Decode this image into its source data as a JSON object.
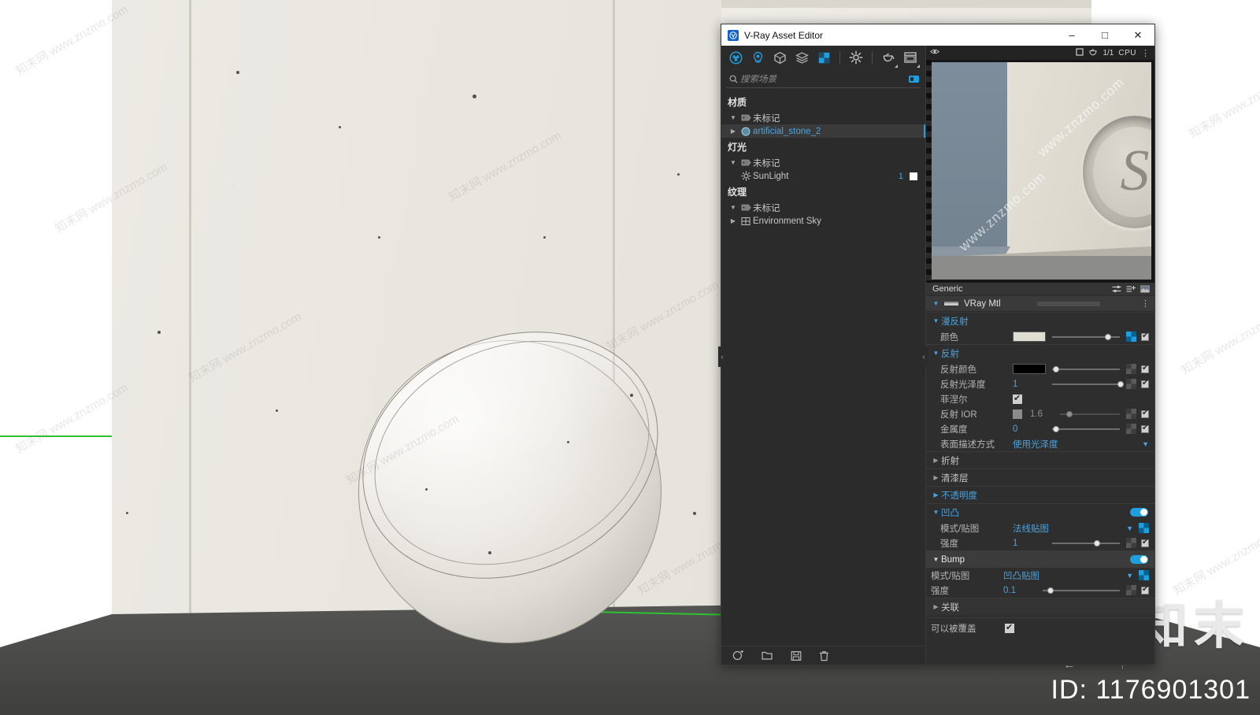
{
  "window": {
    "title": "V-Ray Asset Editor",
    "logo_icon": "vray-logo-icon",
    "minimize": "–",
    "maximize": "□",
    "close": "✕"
  },
  "toolbar": {
    "items": [
      {
        "name": "materials-tab",
        "icon": "sphere-materials-icon",
        "active": true
      },
      {
        "name": "lights-tab",
        "icon": "light-bulb-icon",
        "active": true
      },
      {
        "name": "geometry-tab",
        "icon": "cube-geometry-icon",
        "active": false
      },
      {
        "name": "render-elements-tab",
        "icon": "layers-icon",
        "active": false
      },
      {
        "name": "textures-tab",
        "icon": "checker-texture-icon",
        "active": true
      },
      {
        "name": "settings-tab",
        "icon": "gear-icon",
        "active": false
      },
      {
        "name": "teapot-preview-tab",
        "icon": "teapot-icon",
        "active": false
      },
      {
        "name": "frame-buffer-tab",
        "icon": "window-frame-icon",
        "active": false
      }
    ]
  },
  "search": {
    "placeholder": "搜索场景",
    "icon": "search-icon",
    "clear_badge": "filter-badge-icon"
  },
  "tree": {
    "groups": [
      {
        "title": "材质",
        "rows": [
          {
            "label": "未标记",
            "arrow": "▼",
            "icon": "tag-icon",
            "type": "folder"
          },
          {
            "label": "artificial_stone_2",
            "arrow": "▶",
            "icon": "material-sphere-icon",
            "type": "asset",
            "selected": true
          }
        ]
      },
      {
        "title": "灯光",
        "rows": [
          {
            "label": "未标记",
            "arrow": "▼",
            "icon": "tag-icon",
            "type": "folder"
          },
          {
            "label": "SunLight",
            "arrow": "",
            "icon": "sun-icon",
            "type": "asset",
            "count": "1",
            "swatch": "#ffffff"
          }
        ]
      },
      {
        "title": "纹理",
        "rows": [
          {
            "label": "未标记",
            "arrow": "▼",
            "icon": "tag-icon",
            "type": "folder"
          },
          {
            "label": "Environment Sky",
            "arrow": "▶",
            "icon": "texture-icon",
            "type": "asset"
          }
        ]
      }
    ]
  },
  "bottom_bar": {
    "items": [
      {
        "name": "add-asset-button",
        "icon": "add-asset-icon"
      },
      {
        "name": "open-library-button",
        "icon": "folder-open-icon"
      },
      {
        "name": "save-library-button",
        "icon": "save-icon"
      },
      {
        "name": "delete-asset-button",
        "icon": "trash-icon"
      },
      {
        "name": "import-export-button",
        "icon": "import-export-icon"
      }
    ]
  },
  "preview": {
    "eye_icon": "visibility-icon",
    "stop_icon": "stop-square-icon",
    "teapot_icon": "teapot-icon",
    "resolution": "1/1",
    "engine": "CPU",
    "more_icon": "kebab-menu-icon",
    "watermark": "www.znzmo.com"
  },
  "params_header": {
    "title": "Generic",
    "buttons": [
      {
        "name": "compact-params-button",
        "icon": "sliders-icon"
      },
      {
        "name": "add-layer-button",
        "icon": "add-list-icon"
      },
      {
        "name": "preview-swatch-button",
        "icon": "material-preview-icon"
      }
    ]
  },
  "material": {
    "type_label": "VRay Mtl",
    "type_icon": "material-bar-icon",
    "kebab": "⋮"
  },
  "sections": [
    {
      "id": "diffuse",
      "label": "漫反射",
      "expanded": true,
      "accent": "#4aa3e0",
      "rows": [
        {
          "label": "颜色",
          "control": "color",
          "color": "#e0ddd1",
          "slider": 0.78,
          "tex_slot": "active",
          "end_check": true
        }
      ]
    },
    {
      "id": "reflection",
      "label": "反射",
      "expanded": true,
      "accent": "#4aa3e0",
      "rows": [
        {
          "label": "反射颜色",
          "control": "color",
          "color": "#000000",
          "slider": 0.02,
          "tex_slot": "idle",
          "end_check": true
        },
        {
          "label": "反射光泽度",
          "control": "number",
          "value": "1",
          "slider": 0.97,
          "tex_slot": "idle",
          "end_check": true
        },
        {
          "label": "菲涅尔",
          "control": "checkbox",
          "checked": true
        },
        {
          "label": "反射 IOR",
          "control": "checkbox-number",
          "checked": false,
          "value": "1.6",
          "slider": 0.12,
          "tex_slot": "idle",
          "end_check": true,
          "dim": true
        },
        {
          "label": "金属度",
          "control": "number",
          "value": "0",
          "slider": 0.02,
          "tex_slot": "idle",
          "end_check": true
        },
        {
          "label": "表面描述方式",
          "control": "dropdown",
          "value": "使用光泽度"
        }
      ]
    },
    {
      "id": "refraction",
      "label": "折射",
      "expanded": false,
      "accent": "#c9c9c9"
    },
    {
      "id": "coat",
      "label": "清漆层",
      "expanded": false,
      "accent": "#c9c9c9"
    },
    {
      "id": "opacity",
      "label": "不透明度",
      "expanded": false,
      "accent": "#4aa3e0"
    },
    {
      "id": "bump-cn",
      "label": "凹凸",
      "expanded": true,
      "accent": "#4aa3e0",
      "toggle": true,
      "rows": [
        {
          "label": "模式/贴图",
          "control": "dropdown",
          "value": "法线贴图",
          "tex_slot": "active"
        },
        {
          "label": "强度",
          "control": "number",
          "value": "1",
          "slider": 0.63,
          "tex_slot": "idle",
          "end_check": true
        }
      ]
    },
    {
      "id": "bump-en",
      "label": "Bump",
      "expanded": true,
      "accent": "#ffffff",
      "toggle": true,
      "highlight": true,
      "rows": [
        {
          "label": "模式/贴图",
          "control": "dropdown",
          "value": "凹凸贴图",
          "tex_slot": "active"
        },
        {
          "label": "强度",
          "control": "number",
          "value": "0.1",
          "slider": 0.07,
          "tex_slot": "idle",
          "end_check": true
        }
      ]
    },
    {
      "id": "binding",
      "label": "关联",
      "expanded": false,
      "accent": "#c9c9c9"
    }
  ],
  "footer_option": {
    "label": "可以被覆盖",
    "checked": true
  },
  "watermarks": {
    "brand": "知末",
    "id": "ID: 1176901301",
    "site": "www.znzmo.com",
    "site_cn": "知末网 www.znzmo.com",
    "arrows": "← ↑"
  }
}
